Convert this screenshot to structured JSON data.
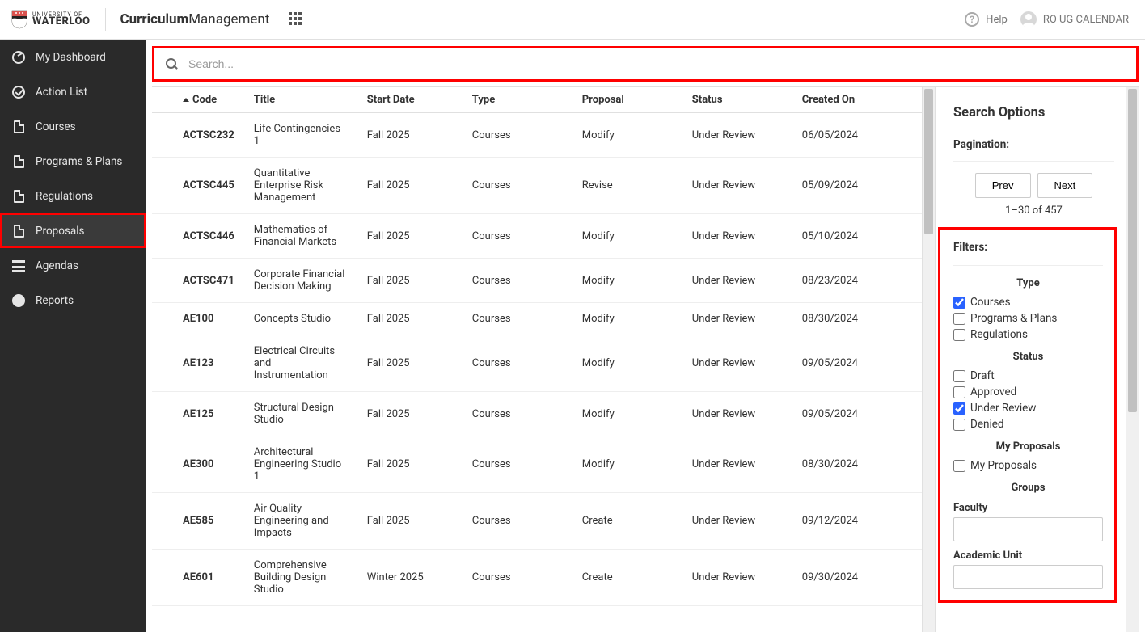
{
  "header": {
    "university_line1": "UNIVERSITY OF",
    "university_line2": "WATERLOO",
    "app_title_bold": "Curriculum",
    "app_title_light": "Management",
    "help_label": "Help",
    "user_name": "RO UG CALENDAR"
  },
  "sidebar": {
    "items": [
      {
        "id": "dashboard",
        "label": "My Dashboard",
        "active": false
      },
      {
        "id": "actionlist",
        "label": "Action List",
        "active": false
      },
      {
        "id": "courses",
        "label": "Courses",
        "active": false
      },
      {
        "id": "programs",
        "label": "Programs & Plans",
        "active": false
      },
      {
        "id": "regulations",
        "label": "Regulations",
        "active": false
      },
      {
        "id": "proposals",
        "label": "Proposals",
        "active": true
      },
      {
        "id": "agendas",
        "label": "Agendas",
        "active": false
      },
      {
        "id": "reports",
        "label": "Reports",
        "active": false
      }
    ]
  },
  "search": {
    "placeholder": "Search..."
  },
  "table": {
    "columns": {
      "code": "Code",
      "title": "Title",
      "start_date": "Start Date",
      "type": "Type",
      "proposal": "Proposal",
      "status": "Status",
      "created_on": "Created On"
    },
    "rows": [
      {
        "code": "ACTSC232",
        "title": "Life Contingencies 1",
        "start_date": "Fall 2025",
        "type": "Courses",
        "proposal": "Modify",
        "status": "Under Review",
        "created_on": "06/05/2024"
      },
      {
        "code": "ACTSC445",
        "title": "Quantitative Enterprise Risk Management",
        "start_date": "Fall 2025",
        "type": "Courses",
        "proposal": "Revise",
        "status": "Under Review",
        "created_on": "05/09/2024"
      },
      {
        "code": "ACTSC446",
        "title": "Mathematics of Financial Markets",
        "start_date": "Fall 2025",
        "type": "Courses",
        "proposal": "Modify",
        "status": "Under Review",
        "created_on": "05/10/2024"
      },
      {
        "code": "ACTSC471",
        "title": "Corporate Financial Decision Making",
        "start_date": "Fall 2025",
        "type": "Courses",
        "proposal": "Modify",
        "status": "Under Review",
        "created_on": "08/23/2024"
      },
      {
        "code": "AE100",
        "title": "Concepts Studio",
        "start_date": "Fall 2025",
        "type": "Courses",
        "proposal": "Modify",
        "status": "Under Review",
        "created_on": "08/30/2024"
      },
      {
        "code": "AE123",
        "title": "Electrical Circuits and Instrumentation",
        "start_date": "Fall 2025",
        "type": "Courses",
        "proposal": "Modify",
        "status": "Under Review",
        "created_on": "09/05/2024"
      },
      {
        "code": "AE125",
        "title": "Structural Design Studio",
        "start_date": "Fall 2025",
        "type": "Courses",
        "proposal": "Modify",
        "status": "Under Review",
        "created_on": "09/05/2024"
      },
      {
        "code": "AE300",
        "title": "Architectural Engineering Studio 1",
        "start_date": "Fall 2025",
        "type": "Courses",
        "proposal": "Modify",
        "status": "Under Review",
        "created_on": "08/30/2024"
      },
      {
        "code": "AE585",
        "title": "Air Quality Engineering and Impacts",
        "start_date": "Fall 2025",
        "type": "Courses",
        "proposal": "Create",
        "status": "Under Review",
        "created_on": "09/12/2024"
      },
      {
        "code": "AE601",
        "title": "Comprehensive Building Design Studio",
        "start_date": "Winter 2025",
        "type": "Courses",
        "proposal": "Create",
        "status": "Under Review",
        "created_on": "09/30/2024"
      }
    ]
  },
  "options": {
    "heading": "Search Options",
    "pagination_label": "Pagination:",
    "prev_label": "Prev",
    "next_label": "Next",
    "range_text": "1–30 of 457",
    "filters_heading": "Filters:",
    "groups": {
      "type": {
        "title": "Type",
        "items": [
          {
            "label": "Courses",
            "checked": true
          },
          {
            "label": "Programs & Plans",
            "checked": false
          },
          {
            "label": "Regulations",
            "checked": false
          }
        ]
      },
      "status": {
        "title": "Status",
        "items": [
          {
            "label": "Draft",
            "checked": false
          },
          {
            "label": "Approved",
            "checked": false
          },
          {
            "label": "Under Review",
            "checked": true
          },
          {
            "label": "Denied",
            "checked": false
          }
        ]
      },
      "my_proposals": {
        "title": "My Proposals",
        "items": [
          {
            "label": "My Proposals",
            "checked": false
          }
        ]
      },
      "groups_section": {
        "title": "Groups",
        "faculty_label": "Faculty",
        "unit_label": "Academic Unit"
      }
    }
  }
}
